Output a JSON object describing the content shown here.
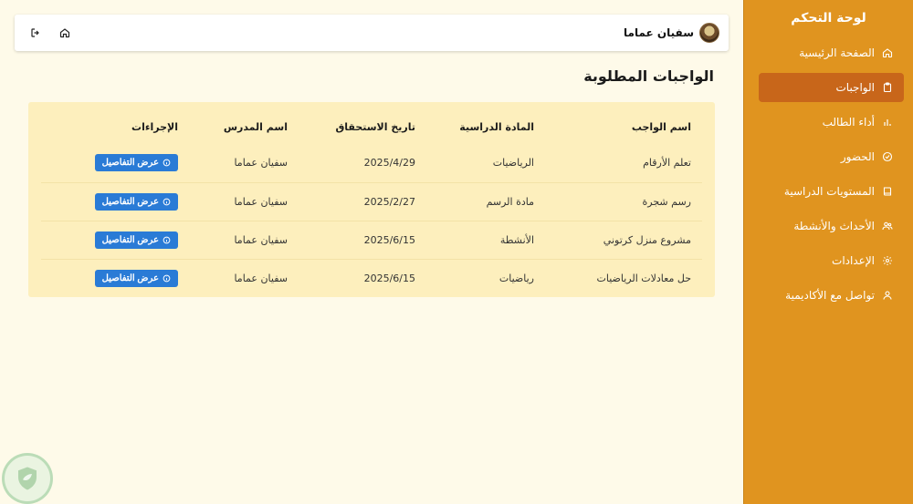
{
  "sidebar": {
    "title": "لوحة التحكم",
    "items": [
      {
        "label": "الصفحة الرئيسية",
        "icon": "home-icon",
        "active": false
      },
      {
        "label": "الواجبات",
        "icon": "clipboard-icon",
        "active": true
      },
      {
        "label": "أداء الطالب",
        "icon": "bar-chart-icon",
        "active": false
      },
      {
        "label": "الحضور",
        "icon": "check-circle-icon",
        "active": false
      },
      {
        "label": "المستويات الدراسية",
        "icon": "book-icon",
        "active": false
      },
      {
        "label": "الأحداث والأنشطة",
        "icon": "users-icon",
        "active": false
      },
      {
        "label": "الإعدادات",
        "icon": "gear-icon",
        "active": false
      },
      {
        "label": "تواصل مع الأكاديمية",
        "icon": "user-icon",
        "active": false
      }
    ]
  },
  "header": {
    "user_name": "سفيان عماما",
    "icons": [
      "home-icon",
      "logout-icon"
    ]
  },
  "main": {
    "title": "الواجبات المطلوبة",
    "table": {
      "columns": [
        "اسم الواجب",
        "المادة الدراسية",
        "تاريخ الاستحقاق",
        "اسم المدرس",
        "الإجراءات"
      ],
      "rows": [
        {
          "name": "تعلم الأرقام",
          "subject": "الرياضيات",
          "due": "2025/4/29",
          "teacher": "سفيان عماما",
          "action": "عرض التفاصيل"
        },
        {
          "name": "رسم شجرة",
          "subject": "مادة الرسم",
          "due": "2025/2/27",
          "teacher": "سفيان عماما",
          "action": "عرض التفاصيل"
        },
        {
          "name": "مشروع منزل كرتوني",
          "subject": "الأنشطة",
          "due": "2025/6/15",
          "teacher": "سفيان عماما",
          "action": "عرض التفاصيل"
        },
        {
          "name": "حل معادلات الرياضيات",
          "subject": "رياضيات",
          "due": "2025/6/15",
          "teacher": "سفيان عماما",
          "action": "عرض التفاصيل"
        }
      ]
    }
  },
  "colors": {
    "sidebar_bg": "#e0941f",
    "sidebar_active": "#c8661a",
    "page_bg": "#fefae9",
    "table_bg": "#fdefbd",
    "button_blue": "#2a7bd6"
  }
}
